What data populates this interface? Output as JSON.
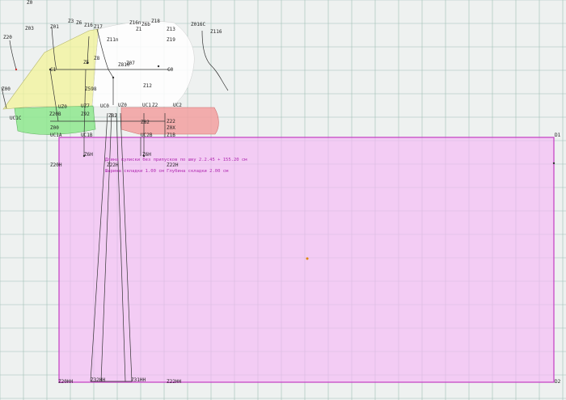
{
  "canvas": {
    "background": "#eef1f0",
    "grid_color": "#9fbfb6",
    "grid_spacing": 29
  },
  "colors": {
    "fill_yellow": "#f3f39a",
    "fill_green": "#8ee88e",
    "fill_red": "#f2a0a0",
    "fill_magenta": "#f6b9f6",
    "magenta_stroke": "#c23cc2",
    "line": "#333333",
    "label": "#222222",
    "info_text": "#b02ab0",
    "point_red": "#cc3333",
    "point_orange": "#dd8800"
  },
  "labels": {
    "top_z0": "Z0",
    "z20": "Z20",
    "z03": "Z03",
    "z3": "Z3",
    "z01": "Z01",
    "z6": "Z6",
    "z16": "Z16",
    "z17": "Z17",
    "z16n": "Z16n",
    "z6b": "Z6b",
    "z18": "Z18",
    "z1": "Z1",
    "z13": "Z13",
    "z016c": "Z016C",
    "z116": "Z116",
    "z11n": "Z11n",
    "z19": "Z19",
    "z5": "Z5",
    "z8": "Z8",
    "z810": "Z810",
    "z00": "Z00",
    "c1": "C1",
    "z07": "Z07",
    "c0": "C0",
    "z12": "Z12",
    "z598": "Z598",
    "uz0": "UZ0",
    "uz0_2": "UZ0",
    "uz7": "UZ7",
    "uc0": "UC0",
    "uc1": "UC1",
    "uc2": "UC2",
    "z2": "Z2",
    "z20b": "Z20B",
    "z92": "Z92",
    "z82": "Z82",
    "z82b": "Z82",
    "z22": "Z22",
    "z00b": "Z00",
    "z0x": "Z0X",
    "ucia": "UC1A",
    "uc1b": "UC1B",
    "uc1c": "UC1C",
    "uc2b": "UC2B",
    "z1b": "Z1B",
    "z6h": "Z6H",
    "z20h": "Z20H",
    "z22h": "Z22H",
    "d1": "D1",
    "z20hh": "Z20HH",
    "z32hh": "Z32HH",
    "z31hh": "Z31HH",
    "z22hh": "Z22HH",
    "d2": "D2"
  },
  "info": {
    "line1": "Длина кулиски без припусков по шву  2.2.45 + 155.20   см",
    "line2": "Ширина складки  1.00   см  Глубина складки  2.00   см"
  }
}
